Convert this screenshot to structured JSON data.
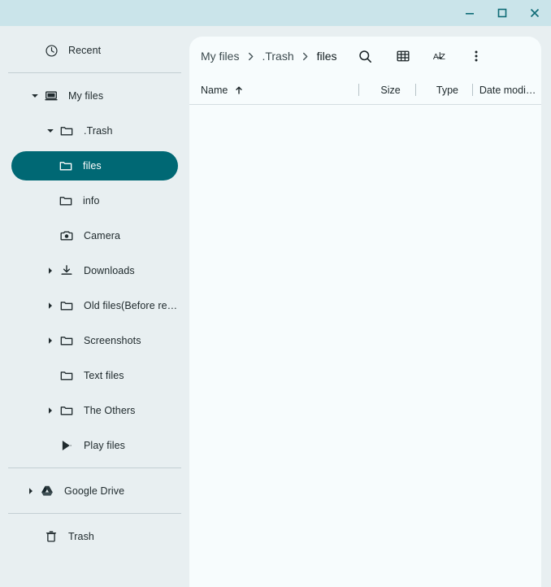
{
  "window": {
    "controls": {
      "minimize_label": "Minimize",
      "maximize_label": "Maximize",
      "close_label": "Close"
    },
    "title_bar_color": "#cae4ea",
    "control_color": "#0e6b76"
  },
  "theme": {
    "sidebar_bg": "#e8eff1",
    "content_bg": "#f7fcfd",
    "selected_bg": "#006874",
    "selected_fg": "#ffffff",
    "text": "#202b2e",
    "divider": "#c3cfd3"
  },
  "sidebar": {
    "recent": {
      "label": "Recent",
      "icon": "clock-icon"
    },
    "items": [
      {
        "label": "My files",
        "icon": "computer-icon",
        "indent": 0,
        "expander": "expanded",
        "selected": false
      },
      {
        "label": ".Trash",
        "icon": "folder-icon",
        "indent": 1,
        "expander": "expanded",
        "selected": false
      },
      {
        "label": "files",
        "icon": "folder-icon",
        "indent": 2,
        "expander": "none",
        "selected": true
      },
      {
        "label": "info",
        "icon": "folder-icon",
        "indent": 2,
        "expander": "none",
        "selected": false
      },
      {
        "label": "Camera",
        "icon": "camera-icon",
        "indent": 1,
        "expander": "none",
        "selected": false
      },
      {
        "label": "Downloads",
        "icon": "download-icon",
        "indent": 1,
        "expander": "collapsed",
        "selected": false
      },
      {
        "label": "Old files(Before re…",
        "icon": "folder-icon",
        "indent": 1,
        "expander": "collapsed",
        "selected": false
      },
      {
        "label": "Screenshots",
        "icon": "folder-icon",
        "indent": 1,
        "expander": "collapsed",
        "selected": false
      },
      {
        "label": "Text files",
        "icon": "folder-icon",
        "indent": 1,
        "expander": "none",
        "selected": false
      },
      {
        "label": "The Others",
        "icon": "folder-icon",
        "indent": 1,
        "expander": "collapsed",
        "selected": false
      },
      {
        "label": "Play files",
        "icon": "play-store-icon",
        "indent": 1,
        "expander": "none",
        "selected": false
      }
    ],
    "google_drive": {
      "label": "Google Drive",
      "icon": "google-drive-icon",
      "expander": "collapsed"
    },
    "trash": {
      "label": "Trash",
      "icon": "trash-icon"
    }
  },
  "toolbar": {
    "breadcrumbs": [
      {
        "label": "My files",
        "current": false
      },
      {
        "label": ".Trash",
        "current": false
      },
      {
        "label": "files",
        "current": true
      }
    ],
    "separator": "chevron-right-icon",
    "buttons": [
      {
        "name": "search-button",
        "icon": "search-icon"
      },
      {
        "name": "view-toggle-button",
        "icon": "grid-view-icon"
      },
      {
        "name": "sort-button",
        "icon": "sort-az-icon"
      },
      {
        "name": "more-options-button",
        "icon": "more-vertical-icon"
      }
    ]
  },
  "columns": {
    "name": "Name",
    "size": "Size",
    "type": "Type",
    "date_modified": "Date modi…",
    "sort_direction": "ascending",
    "sort_icon": "arrow-up-icon"
  },
  "file_list": {
    "rows": [],
    "empty": true
  }
}
